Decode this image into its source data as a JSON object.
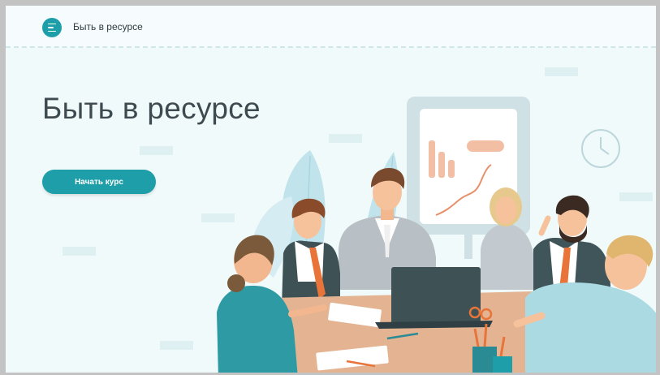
{
  "header": {
    "brand_label": "Быть в ресурсе",
    "menu_icon": "menu-icon"
  },
  "hero": {
    "title": "Быть в ресурсе",
    "start_button_label": "Начать курс"
  },
  "colors": {
    "accent": "#1e9ea8",
    "background": "#f1fafb",
    "title_text": "#3d4a50"
  }
}
